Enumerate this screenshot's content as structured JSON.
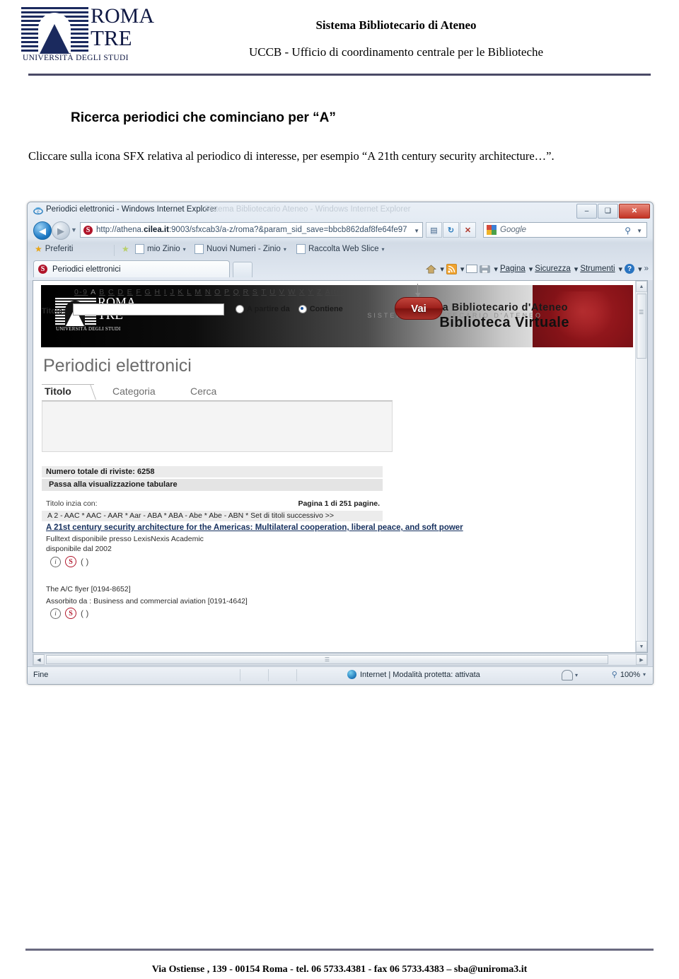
{
  "doc_header": {
    "logo": {
      "line1": "ROMA",
      "line2": "TRE",
      "subtitle": "UNIVERSITÀ DEGLI STUDI"
    },
    "title": "Sistema Bibliotecario di Ateneo",
    "subtitle": "UCCB - Ufficio di coordinamento centrale per le Biblioteche"
  },
  "body": {
    "heading": "Ricerca periodici che cominciano per “A”",
    "paragraph": "Cliccare sulla icona SFX relativa al periodico di interesse, per esempio “A 21th century security architecture…”."
  },
  "browser": {
    "title": "Periodici elettronici - Windows Internet Explorer",
    "ghost_title": "Sistema Bibliotecario Ateneo - Windows Internet Explorer",
    "window_buttons": {
      "minimize": "–",
      "maximize": "❑",
      "close": "✕"
    },
    "nav": {
      "back": "◀",
      "forward": "▶",
      "dropdown": "▼"
    },
    "address": {
      "url_plain_1": "http://athena.",
      "url_bold": "cilea.it",
      "url_plain_2": ":9003/sfxcab3/a-z/roma?&param_sid_save=bbcb862daf8fe64fe97",
      "dropdown": "▼"
    },
    "address_buttons": [
      {
        "name": "compatibility-view",
        "glyph": "▤"
      },
      {
        "name": "refresh",
        "glyph": "↻"
      },
      {
        "name": "stop",
        "glyph": "✕"
      }
    ],
    "search": {
      "engine": "Google",
      "magnifier": "⚲",
      "dropdown": "▼"
    },
    "favorites": {
      "label": "Preferiti",
      "items": [
        {
          "label": "mio Zinio",
          "caret": "▾"
        },
        {
          "label": "Nuovi Numeri - Zinio",
          "caret": "▾"
        },
        {
          "label": "Raccolta Web Slice",
          "caret": "▾"
        }
      ]
    },
    "tab": {
      "label": "Periodici elettronici"
    },
    "command_bar": {
      "items": [
        {
          "name": "home",
          "label": "",
          "caret": "▾"
        },
        {
          "name": "feeds",
          "label": "",
          "caret": "▾"
        },
        {
          "name": "mail",
          "label": "",
          "caret": ""
        },
        {
          "name": "print",
          "label": "",
          "caret": "▾"
        },
        {
          "name": "page",
          "label": "Pagina",
          "caret": "▾"
        },
        {
          "name": "safety",
          "label": "Sicurezza",
          "caret": "▾"
        },
        {
          "name": "tools",
          "label": "Strumenti",
          "caret": "▾"
        },
        {
          "name": "help",
          "label": "",
          "caret": "▾"
        }
      ],
      "overflow": "»"
    },
    "status": {
      "left": "Fine",
      "zone": "Internet | Modalità protetta: attivata",
      "zoom": "100%",
      "zoom_caret": "▾",
      "zone_caret": "▾"
    }
  },
  "site": {
    "banner": {
      "logo_line1": "ROMA",
      "logo_line2": "TRE",
      "logo_sub": "UNIVERSITÀ DEGLI STUDI",
      "title_top": "Sistema  Bibliotecario d'Ateneo",
      "title_main": "Biblioteca Virtuale",
      "ghost": "SISTEMA BIBLIOTECARIO D'ATENEO"
    },
    "page_heading": "Periodici elettronici",
    "tabs": [
      {
        "label": "Titolo",
        "active": true
      },
      {
        "label": "Categoria",
        "active": false
      },
      {
        "label": "Cerca",
        "active": false
      }
    ],
    "alphabet": {
      "first": "0-9",
      "letters": [
        "A",
        "B",
        "C",
        "D",
        "E",
        "F",
        "G",
        "H",
        "I",
        "J",
        "K",
        "L",
        "M",
        "N",
        "O",
        "P",
        "Q",
        "R",
        "S",
        "T",
        "U",
        "V",
        "W",
        "X",
        "Y",
        "Z"
      ],
      "current": "A",
      "last": "Altro"
    },
    "form": {
      "title_label": "Titolo:",
      "title_value": "",
      "radio_starts": "A partire da",
      "radio_contains": "Contiene",
      "selected_radio": "Contiene",
      "submit": "Vai"
    },
    "results": {
      "total": "Numero totale di riviste: 6258",
      "tabular_link": "Passa alla visualizzazione tabulare",
      "starts_with_label": "Titolo inzia con:",
      "pagination": "Pagina 1 di 251 pagine.",
      "ranges": "A 2 - AAC * AAC - AAR * Aar - ABA * ABA - Abe * Abe - ABN * Set di titoli successivo >>",
      "items": [
        {
          "title": "A 21st century security architecture for the Americas: Multilateral cooperation, liberal peace, and soft power",
          "fulltext": "Fulltext disponibile presso LexisNexis Academic",
          "available": "disponibile dal 2002",
          "icons": [
            "info-icon",
            "sfx-icon",
            "paren-icon"
          ]
        },
        {
          "title": "The A/C flyer [0194-8652]",
          "absorbed": "Assorbito da : Business and commercial aviation [0191-4642]",
          "icons": [
            "info-icon",
            "sfx-icon",
            "paren-icon"
          ]
        }
      ]
    }
  },
  "footer": {
    "text": "Via Ostiense , 139 - 00154 Roma - tel. 06 5733.4381 - fax 06 5733.4383 – sba@uniroma3.it"
  },
  "colors": {
    "brand_navy": "#101944",
    "sfx_red": "#b0152a",
    "banner_red": "#8b1419",
    "link_blue": "#16305e"
  }
}
